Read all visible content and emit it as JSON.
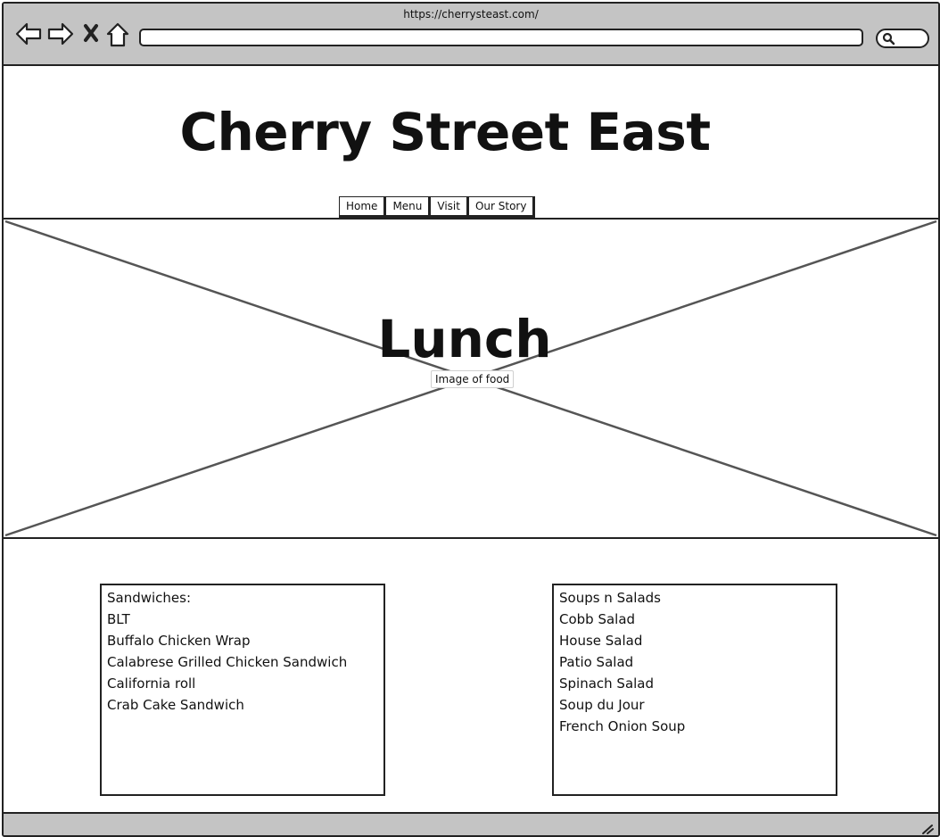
{
  "browser": {
    "url": "https://cherrysteast.com/"
  },
  "header": {
    "site_title": "Cherry Street East",
    "nav": [
      "Home",
      "Menu",
      "Visit",
      "Our Story"
    ]
  },
  "hero": {
    "title": "Lunch",
    "caption": "Image of food"
  },
  "menu": {
    "sandwiches": {
      "heading": "Sandwiches:",
      "items": [
        "BLT",
        "Buffalo Chicken Wrap",
        "Calabrese Grilled Chicken Sandwich",
        "California roll",
        "Crab Cake Sandwich"
      ]
    },
    "soups_salads": {
      "heading": "Soups n Salads",
      "items": [
        "Cobb Salad",
        "House Salad",
        "Patio Salad",
        "Spinach Salad",
        "Soup du Jour",
        "French Onion Soup"
      ]
    }
  },
  "icons": {
    "back": "back-arrow-icon",
    "forward": "forward-arrow-icon",
    "stop": "close-icon",
    "home": "home-icon",
    "search": "search-icon",
    "resize": "resize-grip-icon"
  },
  "colors": {
    "chrome": "#c4c4c4",
    "stroke": "#222222",
    "placeholder_x": "#555555"
  }
}
